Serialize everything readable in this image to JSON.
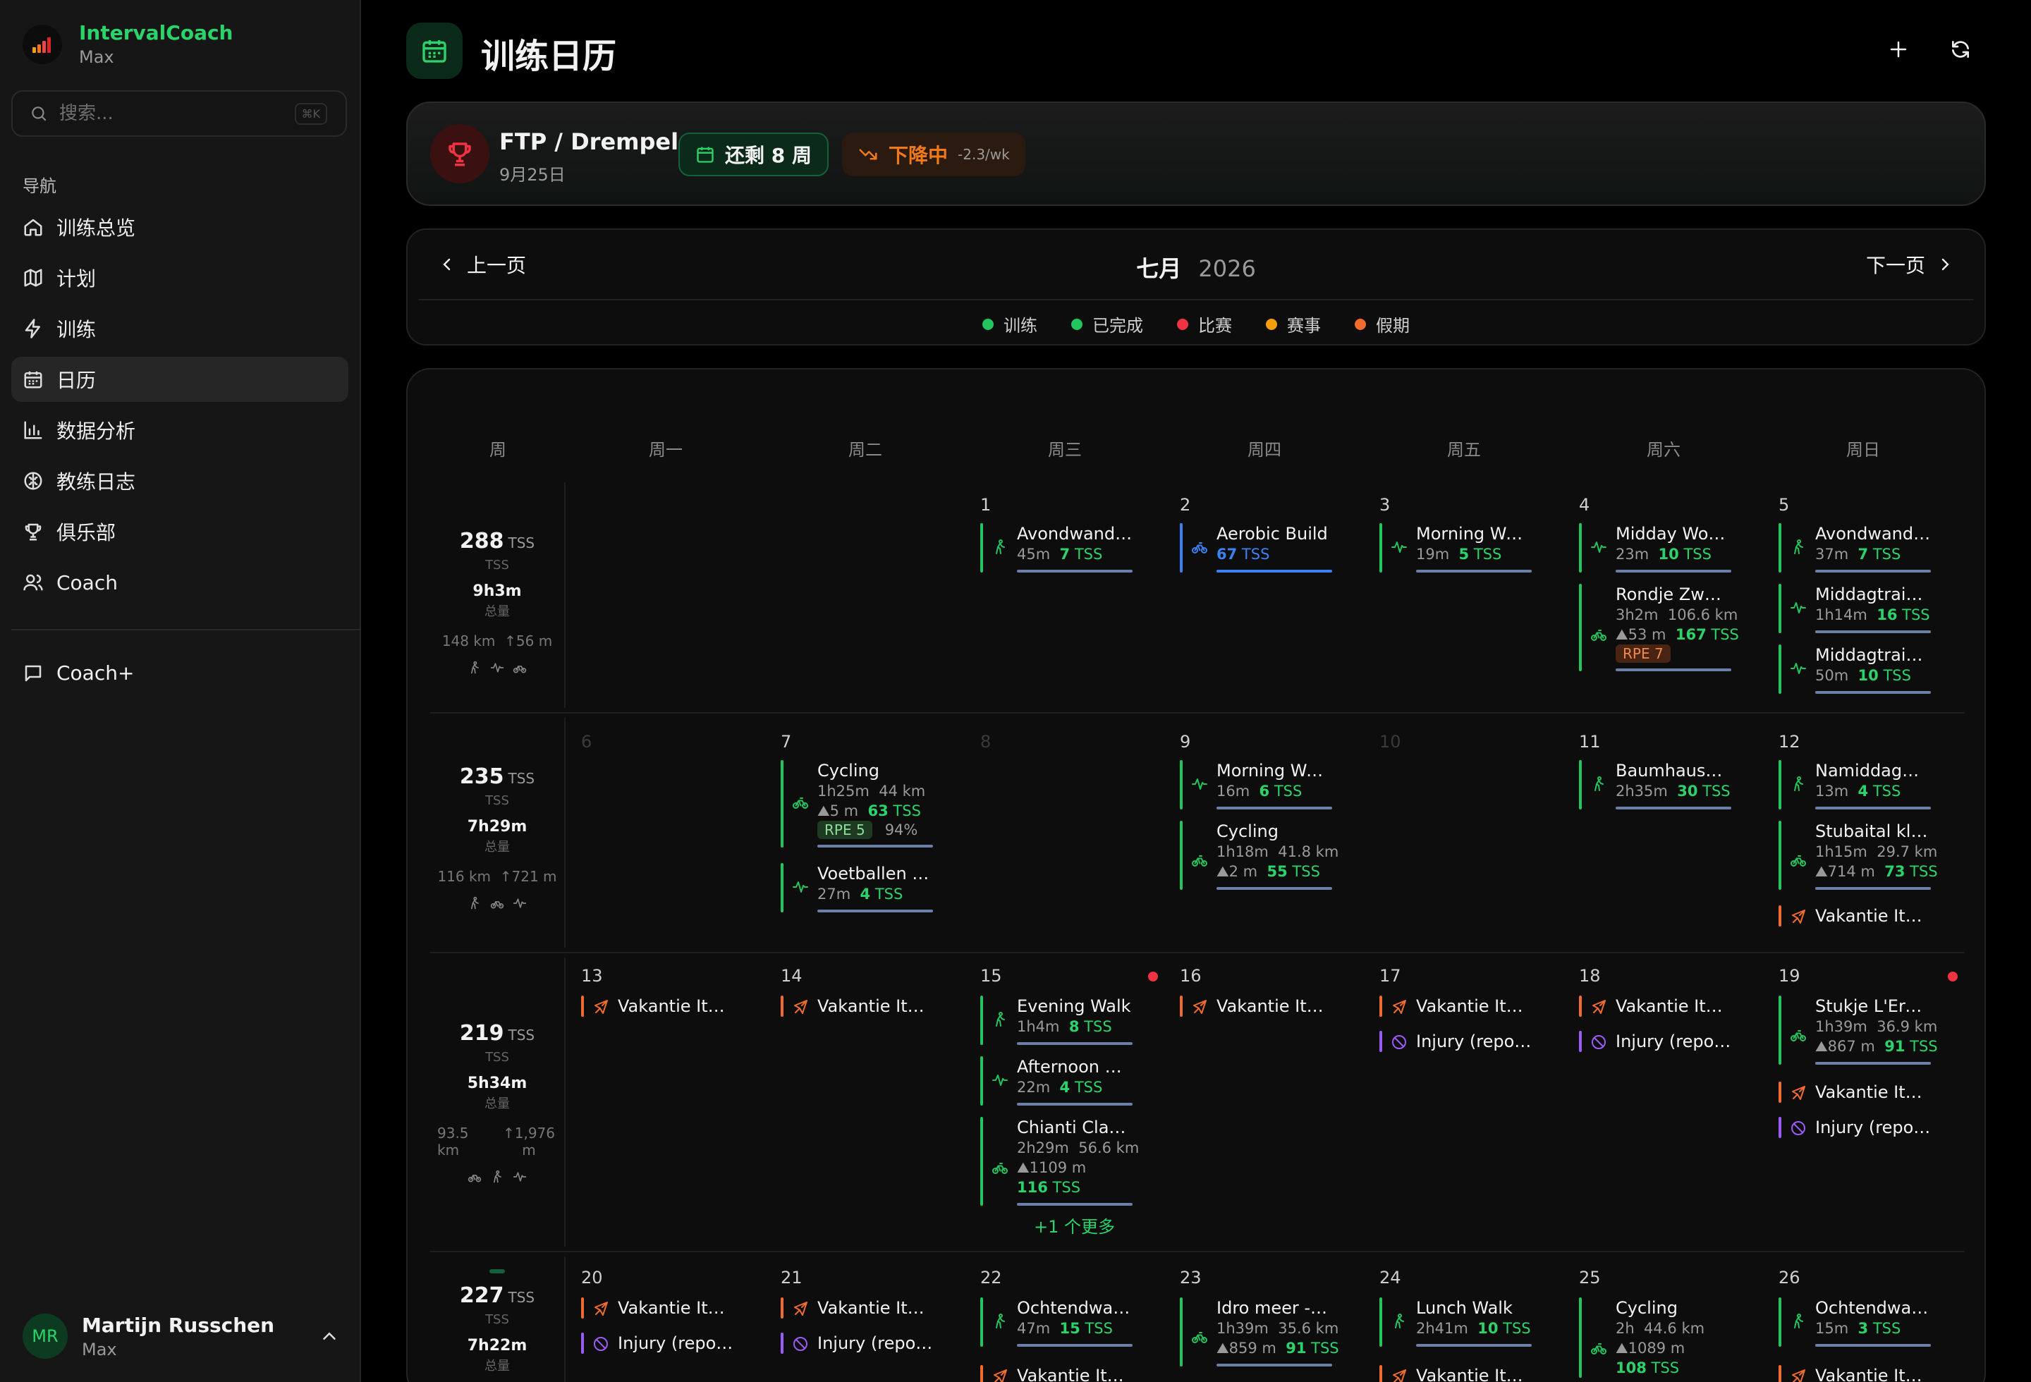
{
  "app": {
    "name": "IntervalCoach",
    "user_short": "Max",
    "search_placeholder": "搜索...",
    "search_shortcut": "⌘K",
    "nav_section": "导航",
    "nav": [
      {
        "label": "训练总览",
        "icon": "home-icon"
      },
      {
        "label": "计划",
        "icon": "map-icon"
      },
      {
        "label": "训练",
        "icon": "lightning-icon"
      },
      {
        "label": "日历",
        "icon": "calendar-icon",
        "active": true
      },
      {
        "label": "数据分析",
        "icon": "bar-chart-icon"
      },
      {
        "label": "教练日志",
        "icon": "brain-icon"
      },
      {
        "label": "俱乐部",
        "icon": "trophy-icon"
      },
      {
        "label": "Coach",
        "icon": "users-icon"
      }
    ],
    "coach_plus": "Coach+",
    "user": {
      "initials": "MR",
      "name": "Martijn Russchen",
      "sub": "Max"
    }
  },
  "header": {
    "title": "训练日历"
  },
  "goal": {
    "title": "FTP / Drempel",
    "date": "9月25日",
    "weeks_left": "还剩 8 周",
    "trend": "下降中",
    "trend_rate": "-2.3/wk"
  },
  "month": {
    "prev": "上一页",
    "next": "下一页",
    "name": "七月",
    "year": "2026",
    "legend": [
      {
        "label": "训练",
        "color": "#22c55e"
      },
      {
        "label": "已完成",
        "color": "#22c55e"
      },
      {
        "label": "比赛",
        "color": "#ef3340"
      },
      {
        "label": "赛事",
        "color": "#f59e0b"
      },
      {
        "label": "假期",
        "color": "#f26b2e"
      }
    ]
  },
  "calendar": {
    "headers": [
      "周",
      "周一",
      "周二",
      "周三",
      "周四",
      "周五",
      "周六",
      "周日"
    ],
    "more_link": "+1 个更多",
    "weeks": [
      {
        "tss": "288",
        "unit": "TSS",
        "tss_label": "TSS",
        "duration": "9h3m",
        "duration_label": "总量",
        "dist": "148 km",
        "elev": "↑56 m"
      },
      {
        "tss": "235",
        "unit": "TSS",
        "tss_label": "TSS",
        "duration": "7h29m",
        "duration_label": "总量",
        "dist": "116 km",
        "elev": "↑721 m"
      },
      {
        "tss": "219",
        "unit": "TSS",
        "tss_label": "TSS",
        "duration": "5h34m",
        "duration_label": "总量",
        "dist": "93.5 km",
        "elev": "↑1,976 m"
      },
      {
        "tss": "227",
        "unit": "TSS",
        "tss_label": "TSS",
        "duration": "7h22m",
        "duration_label": "总量",
        "dist": "",
        "elev": ""
      }
    ],
    "days": {
      "w1": [
        "1",
        "2",
        "3",
        "4",
        "5"
      ],
      "w2": [
        "6",
        "7",
        "8",
        "9",
        "10",
        "11",
        "12"
      ],
      "w3": [
        "13",
        "14",
        "15",
        "16",
        "17",
        "18",
        "19"
      ],
      "w4": [
        "20",
        "21",
        "22",
        "23",
        "24",
        "25",
        "26"
      ]
    },
    "events": {
      "e1": {
        "title": "Avondwandeling",
        "dur": "45m",
        "tss": "7",
        "unit": "TSS"
      },
      "e2": {
        "title": "Aerobic Build",
        "tss": "67",
        "unit": "TSS"
      },
      "e3": {
        "title": "Morning Workout",
        "dur": "19m",
        "tss": "5",
        "unit": "TSS"
      },
      "e4": {
        "title": "Midday Workout",
        "dur": "23m",
        "tss": "10",
        "unit": "TSS"
      },
      "e5": {
        "title": "Rondje Zwolle en omgeving",
        "dur": "3h2m",
        "dist": "106.6 km",
        "elev": "⛰53 m",
        "tss": "167",
        "unit": "TSS",
        "rpe": "RPE 7"
      },
      "e6": {
        "title": "Avondwandeling",
        "dur": "37m",
        "tss": "7",
        "unit": "TSS"
      },
      "e7": {
        "title": "Middagtraining",
        "dur": "1h14m",
        "tss": "16",
        "unit": "TSS"
      },
      "e8": {
        "title": "Middagtraining",
        "dur": "50m",
        "tss": "10",
        "unit": "TSS"
      },
      "e9": {
        "title": "Cycling",
        "dur": "1h25m",
        "dist": "44 km",
        "elev": "⛰5 m",
        "tss": "63",
        "unit": "TSS",
        "rpe": "RPE 5",
        "pct": "94%"
      },
      "e10": {
        "title": "Voetballen in de tuin",
        "dur": "27m",
        "tss": "4",
        "unit": "TSS"
      },
      "e11": {
        "title": "Morning Workout",
        "dur": "16m",
        "tss": "6",
        "unit": "TSS"
      },
      "e12": {
        "title": "Cycling",
        "dur": "1h18m",
        "dist": "41.8 km",
        "elev": "⛰2 m",
        "tss": "55",
        "unit": "TSS"
      },
      "e13": {
        "title": "Baumhausweg",
        "dur": "2h35m",
        "tss": "30",
        "unit": "TSS"
      },
      "e14": {
        "title": "Namiddagwandeling",
        "dur": "13m",
        "tss": "4",
        "unit": "TSS"
      },
      "e15": {
        "title": "Stubaital klim en afdaling",
        "dur": "1h15m",
        "dist": "29.7 km",
        "elev": "⛰714 m",
        "tss": "73",
        "unit": "TSS"
      },
      "e16": {
        "title": "Vakantie Italie"
      },
      "e17": {
        "title": "Vakantie Italie"
      },
      "e18": {
        "title": "Vakantie Italie"
      },
      "e19": {
        "title": "Evening Walk",
        "dur": "1h4m",
        "tss": "8",
        "unit": "TSS"
      },
      "e20": {
        "title": "Afternoon Workout",
        "dur": "22m",
        "tss": "4",
        "unit": "TSS"
      },
      "e21": {
        "title": "Chianti Classico",
        "dur": "2h29m",
        "dist": "56.6 km",
        "elev": "⛰1109 m",
        "tss": "116",
        "unit": "TSS"
      },
      "e22": {
        "title": "Vakantie Italie"
      },
      "e23": {
        "title": "Vakantie Italie"
      },
      "e24": {
        "title": "Injury (reported)"
      },
      "e25": {
        "title": "Vakantie Italie"
      },
      "e26": {
        "title": "Injury (reported)"
      },
      "e27": {
        "title": "Stukje L'Eroica",
        "dur": "1h39m",
        "dist": "36.9 km",
        "elev": "⛰867 m",
        "tss": "91",
        "unit": "TSS"
      },
      "e28": {
        "title": "Vakantie Italie"
      },
      "e29": {
        "title": "Injury (reported)"
      },
      "e30": {
        "title": "Vakantie Italie"
      },
      "e31": {
        "title": "Injury (reported)"
      },
      "e32": {
        "title": "Vakantie Italie"
      },
      "e33": {
        "title": "Injury (reported)"
      },
      "e34": {
        "title": "Ochtendwandeling",
        "dur": "47m",
        "tss": "15",
        "unit": "TSS"
      },
      "e35": {
        "title": "Vakantie Italie"
      },
      "e36": {
        "title": "Idro meer - Rondje",
        "dur": "1h39m",
        "dist": "35.6 km",
        "elev": "⛰859 m",
        "tss": "91",
        "unit": "TSS"
      },
      "e37": {
        "title": "Lunch Walk",
        "dur": "2h41m",
        "tss": "10",
        "unit": "TSS"
      },
      "e38": {
        "title": "Vakantie Italie"
      },
      "e39": {
        "title": "Cycling",
        "dur": "2h",
        "dist": "44.6 km",
        "elev": "⛰1089 m",
        "tss": "108",
        "unit": "TSS"
      },
      "e40": {
        "title": "Ochtendwandeling",
        "dur": "15m",
        "tss": "3",
        "unit": "TSS"
      },
      "e41": {
        "title": "Vakantie Italie"
      }
    }
  },
  "colors": {
    "accent": "#2ad46a",
    "workout": "#22c55e",
    "vacation": "#f26b2e",
    "injury": "#9b5cf6",
    "plan_blue": "#3b82f6",
    "race": "#ef3340"
  }
}
